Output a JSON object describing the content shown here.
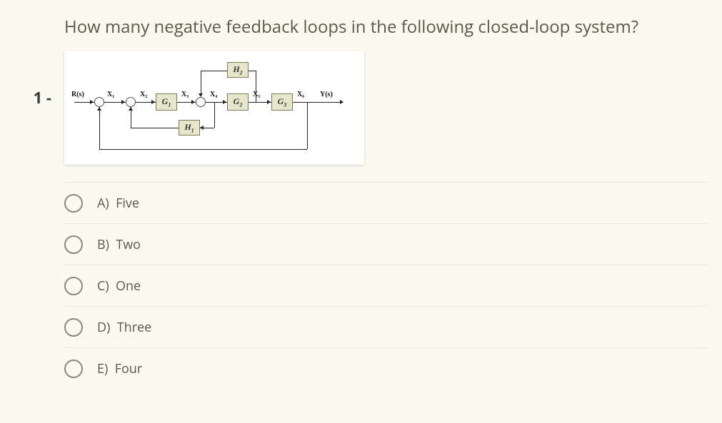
{
  "question": {
    "number": "1 -",
    "text": "How many negative feedback loops in the following closed-loop system?"
  },
  "diagram": {
    "input": "R(s)",
    "output": "Y(s)",
    "nodes": {
      "x1": "X₁",
      "x2": "X₂",
      "x3": "X₃",
      "x4": "X₄",
      "x5": "X₅",
      "x6": "X₆"
    },
    "blocks": {
      "G1": "G₁",
      "G2": "G₂",
      "G3": "G₃",
      "H1": "H₁",
      "H2": "H₂"
    }
  },
  "options": [
    {
      "key": "A",
      "text": "Five"
    },
    {
      "key": "B",
      "text": "Two"
    },
    {
      "key": "C",
      "text": "One"
    },
    {
      "key": "D",
      "text": "Three"
    },
    {
      "key": "E",
      "text": "Four"
    }
  ]
}
